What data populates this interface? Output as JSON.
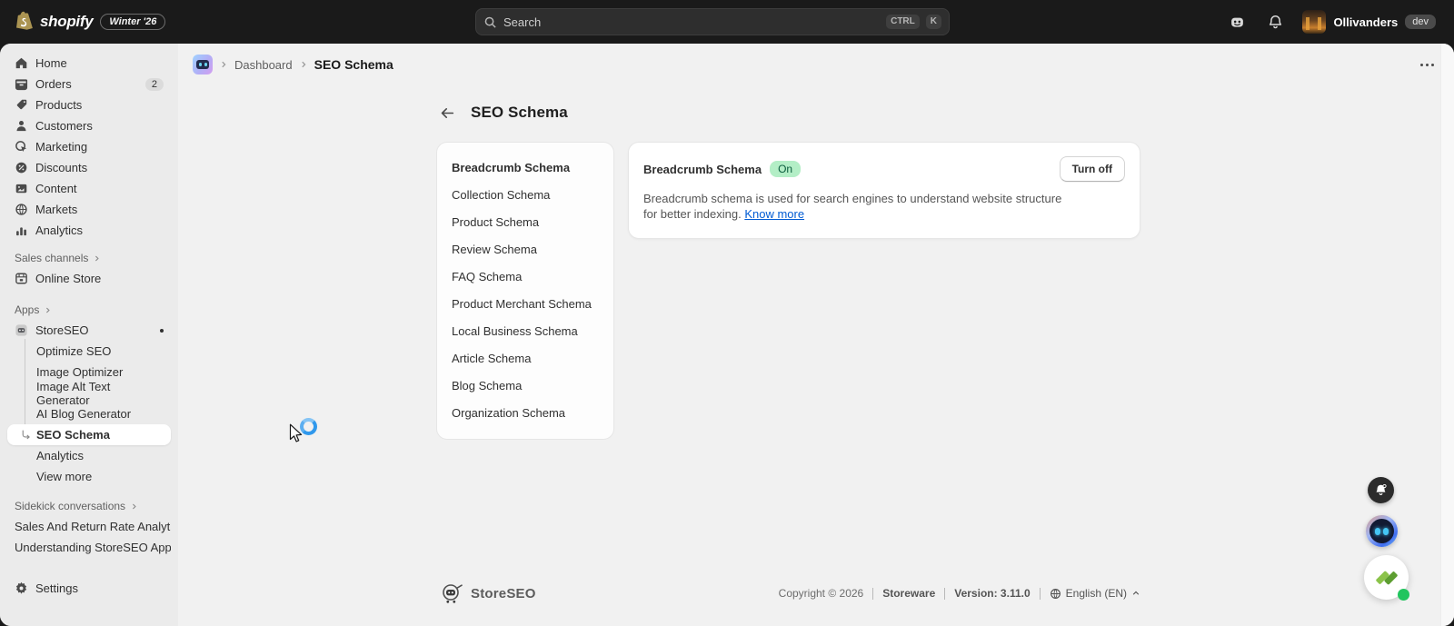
{
  "topbar": {
    "brand": "shopify",
    "edition_badge": "Winter '26",
    "search": {
      "placeholder": "Search",
      "key1": "CTRL",
      "key2": "K"
    },
    "user": {
      "name": "Ollivanders",
      "badge": "dev"
    }
  },
  "sidebar": {
    "items": [
      {
        "label": "Home"
      },
      {
        "label": "Orders",
        "badge": "2"
      },
      {
        "label": "Products"
      },
      {
        "label": "Customers"
      },
      {
        "label": "Marketing"
      },
      {
        "label": "Discounts"
      },
      {
        "label": "Content"
      },
      {
        "label": "Markets"
      },
      {
        "label": "Analytics"
      }
    ],
    "sales_channels": {
      "header": "Sales channels",
      "online_store": "Online Store"
    },
    "apps": {
      "header": "Apps",
      "app_name": "StoreSEO",
      "sub_items": [
        {
          "label": "Optimize SEO"
        },
        {
          "label": "Image Optimizer"
        },
        {
          "label": "Image Alt Text Generator"
        },
        {
          "label": "AI Blog Generator"
        },
        {
          "label": "SEO Schema",
          "selected": true
        },
        {
          "label": "Analytics"
        },
        {
          "label": "View more"
        }
      ]
    },
    "sidekick": {
      "header": "Sidekick conversations",
      "items": [
        {
          "label": "Sales And Return Rate Analyti..."
        },
        {
          "label": "Understanding StoreSEO App ..."
        }
      ]
    },
    "settings_label": "Settings"
  },
  "breadcrumb": {
    "parent": "Dashboard",
    "current": "SEO Schema"
  },
  "page": {
    "title": "SEO Schema"
  },
  "schema_list": {
    "items": [
      "Breadcrumb Schema",
      "Collection Schema",
      "Product Schema",
      "Review Schema",
      "FAQ Schema",
      "Product Merchant Schema",
      "Local Business Schema",
      "Article Schema",
      "Blog Schema",
      "Organization Schema"
    ],
    "selected": "Breadcrumb Schema"
  },
  "detail": {
    "title": "Breadcrumb Schema",
    "status": "On",
    "action": "Turn off",
    "description": "Breadcrumb schema is used for search engines to understand website structure for better indexing.",
    "link": "Know more"
  },
  "footer": {
    "logo_text": "StoreSEO",
    "copyright": "Copyright © 2026",
    "company": "Storeware",
    "version": "Version: 3.11.0",
    "language": "English (EN)"
  },
  "colors": {
    "topbar_bg": "#1a1a1a",
    "surface_bg": "#f1f1f1",
    "sidebar_bg": "#ebebeb",
    "success_badge_bg": "#b3eec6",
    "success_badge_text": "#0a5c3d",
    "link_blue": "#005bd3",
    "spinner_blue": "#2f98ec",
    "online_dot_green": "#22c55e"
  }
}
